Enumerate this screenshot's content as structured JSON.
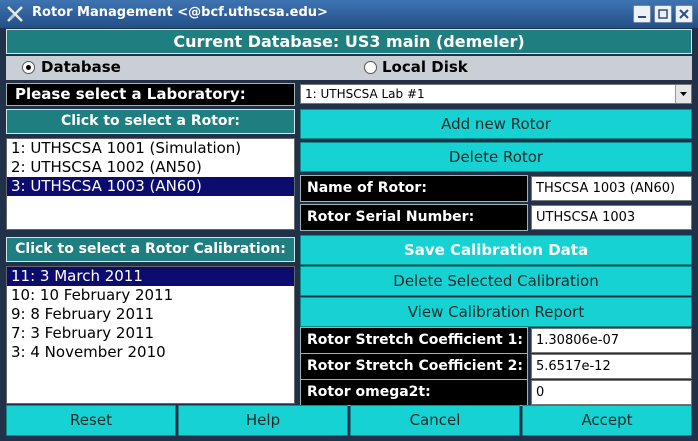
{
  "window": {
    "title": "Rotor Management <@bcf.uthscsa.edu>",
    "icon": "x-tools-icon"
  },
  "current_database": "Current Database: US3 main (demeler)",
  "source": {
    "options": [
      "Database",
      "Local Disk"
    ],
    "selected": "Database"
  },
  "laboratory": {
    "label": "Please select a Laboratory:",
    "selected": "1: UTHSCSA Lab #1"
  },
  "rotors": {
    "header": "Click to select a Rotor:",
    "items": [
      "1: UTHSCSA 1001 (Simulation)",
      "2: UTHSCSA 1002 (AN50)",
      "3: UTHSCSA 1003 (AN60)"
    ],
    "selected_index": 2
  },
  "rotor_actions": {
    "add": "Add new Rotor",
    "delete": "Delete Rotor"
  },
  "rotor_info": {
    "name_label": "Name of Rotor:",
    "name_value": "THSCSA 1003 (AN60)",
    "serial_label": "Rotor Serial Number:",
    "serial_value": "UTHSCSA 1003"
  },
  "calibrations": {
    "header": "Click to select a Rotor Calibration:",
    "items": [
      "11: 3 March 2011",
      "10: 10 February 2011",
      "9: 8 February 2011",
      "7: 3 February 2011",
      "3: 4 November 2010"
    ],
    "selected_index": 0
  },
  "calibration_actions": {
    "save": "Save Calibration Data",
    "delete": "Delete Selected Calibration",
    "view": "View Calibration Report"
  },
  "coefficients": {
    "c1_label": "Rotor Stretch Coefficient 1:",
    "c1_value": "1.30806e-07",
    "c2_label": "Rotor Stretch Coefficient 2:",
    "c2_value": "5.6517e-12",
    "omega_label": "Rotor omega2t:",
    "omega_value": "0"
  },
  "footer": {
    "reset": "Reset",
    "help": "Help",
    "cancel": "Cancel",
    "accept": "Accept"
  },
  "colors": {
    "teal_header": "#1f7f80",
    "button": "#16d2d2",
    "selection": "#0c0c6e",
    "titlebar": "#2f5f99"
  }
}
